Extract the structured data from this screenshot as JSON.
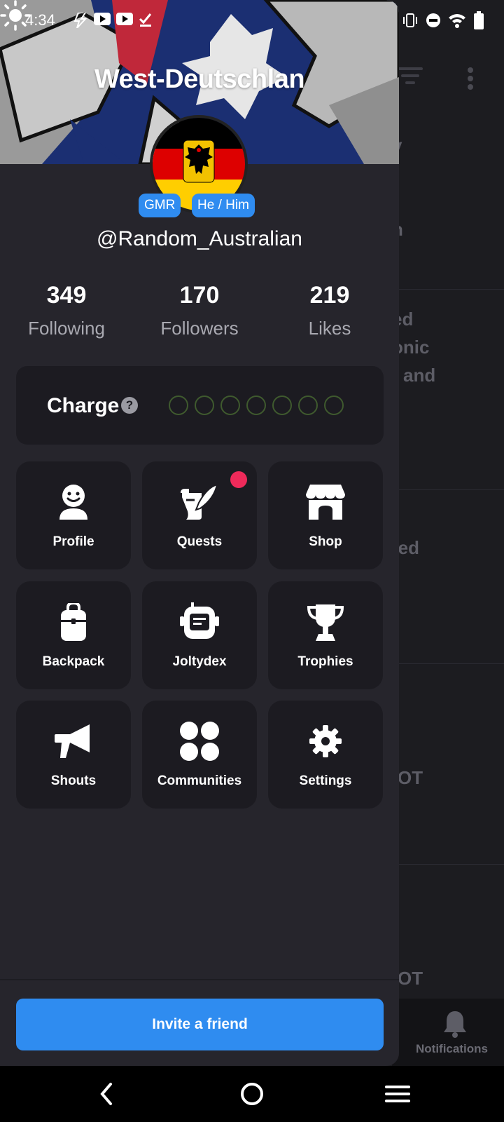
{
  "status_bar": {
    "time": "4:34"
  },
  "banner": {
    "title": "West-Deutschlan"
  },
  "profile": {
    "tags": [
      "GMR",
      "He / Him"
    ],
    "handle": "@Random_Australian"
  },
  "stats": [
    {
      "value": "349",
      "label": "Following"
    },
    {
      "value": "170",
      "label": "Followers"
    },
    {
      "value": "219",
      "label": "Likes"
    }
  ],
  "charge": {
    "label": "Charge",
    "help": "?",
    "filled": 0,
    "total": 7
  },
  "tiles": [
    {
      "label": "Profile",
      "icon": "person-icon"
    },
    {
      "label": "Quests",
      "icon": "quill-scroll-icon",
      "badge": true
    },
    {
      "label": "Shop",
      "icon": "storefront-icon"
    },
    {
      "label": "Backpack",
      "icon": "backpack-icon"
    },
    {
      "label": "Joltydex",
      "icon": "joltydex-device-icon"
    },
    {
      "label": "Trophies",
      "icon": "trophy-icon"
    },
    {
      "label": "Shouts",
      "icon": "megaphone-icon"
    },
    {
      "label": "Communities",
      "icon": "communities-icon"
    },
    {
      "label": "Settings",
      "icon": "gear-icon"
    }
  ],
  "invite": {
    "label": "Invite a friend"
  },
  "background": {
    "fragments": [
      "y",
      "n",
      "ed",
      "onic",
      "and",
      "ted",
      "OT",
      "OT"
    ],
    "notifications_label": "Notifications"
  },
  "colors": {
    "accent": "#2f8cf0",
    "badge": "#ee2a5a",
    "drawer": "#26252c",
    "tile": "#1c1b21"
  }
}
